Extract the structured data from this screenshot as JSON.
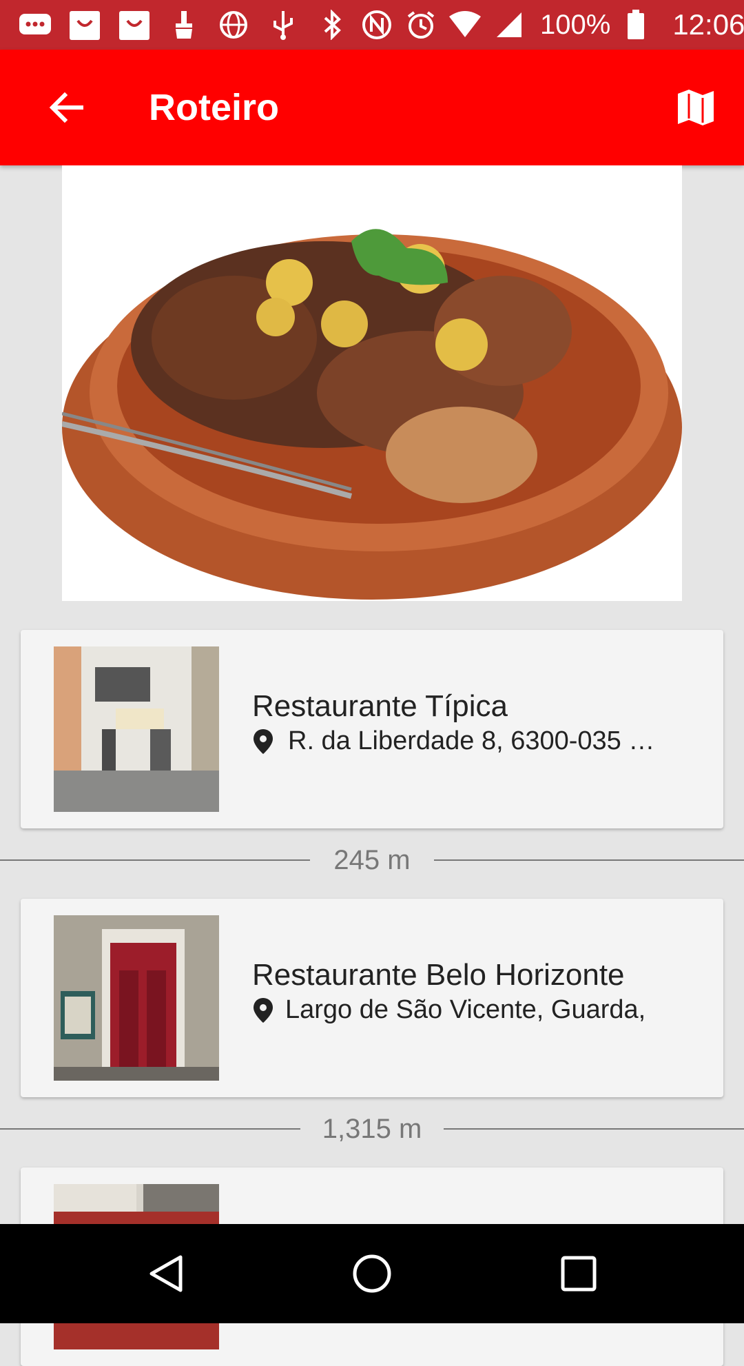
{
  "status_bar": {
    "battery": "100%",
    "time": "12:06",
    "left_icons": [
      "message-icon",
      "bag-icon",
      "bag-icon",
      "cleaner-icon",
      "globe-icon",
      "usb-icon"
    ],
    "right_icons": [
      "bluetooth-icon",
      "nfc-icon",
      "alarm-icon",
      "wifi-icon",
      "signal-icon",
      "battery-icon"
    ]
  },
  "app_bar": {
    "title": "Roteiro",
    "back_icon": "arrow-back-icon",
    "map_icon": "map-icon",
    "background": "#ff0000"
  },
  "hero": {
    "image": "roast-meat-dish-photo"
  },
  "places": [
    {
      "name": "Restaurante Típica",
      "address": "R. da Liberdade 8, 6300-035 …",
      "thumbnail": "restaurant-tipica-photo"
    },
    {
      "name": "Restaurante Belo Horizonte",
      "address": "Largo de São Vicente, Guarda,",
      "thumbnail": "restaurant-belo-horizonte-photo"
    }
  ],
  "distances": [
    "245 m",
    "1,315 m"
  ],
  "nav_bar": {
    "back": "nav-back-icon",
    "home": "nav-home-icon",
    "recents": "nav-recents-icon"
  }
}
